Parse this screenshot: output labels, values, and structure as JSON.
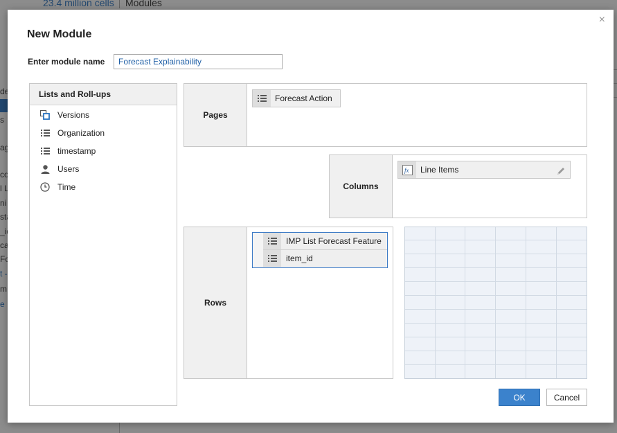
{
  "background": {
    "cells_text": "23.4 million cells",
    "modules_text": "Modules",
    "left_fragments": [
      "de",
      "s",
      "ag",
      "col",
      "l L",
      "ni",
      "sta",
      "_id",
      "ca",
      "Fo",
      "t -",
      "m",
      "e"
    ]
  },
  "dialog": {
    "title": "New Module",
    "close_glyph": "×",
    "name_label": "Enter module name",
    "name_value": "Forecast Explainability"
  },
  "lists": {
    "header": "Lists and Roll-ups",
    "items": [
      {
        "label": "Versions",
        "icon": "versions-icon"
      },
      {
        "label": "Organization",
        "icon": "list-icon"
      },
      {
        "label": "timestamp",
        "icon": "list-icon"
      },
      {
        "label": "Users",
        "icon": "user-icon"
      },
      {
        "label": "Time",
        "icon": "clock-icon"
      }
    ]
  },
  "pages": {
    "label": "Pages",
    "items": [
      {
        "label": "Forecast Action",
        "icon": "list-icon"
      }
    ]
  },
  "columns": {
    "label": "Columns",
    "items": [
      {
        "label": "Line Items",
        "icon": "formula-icon"
      }
    ]
  },
  "rows": {
    "label": "Rows",
    "items": [
      {
        "label": "IMP List Forecast Feature",
        "icon": "list-icon"
      },
      {
        "label": "item_id",
        "icon": "list-icon"
      }
    ]
  },
  "buttons": {
    "ok": "OK",
    "cancel": "Cancel"
  },
  "colors": {
    "accent": "#3b82cc",
    "link": "#1f5fa6",
    "selection_border": "#3d7bc6",
    "grid_fill": "#eef2f8"
  }
}
